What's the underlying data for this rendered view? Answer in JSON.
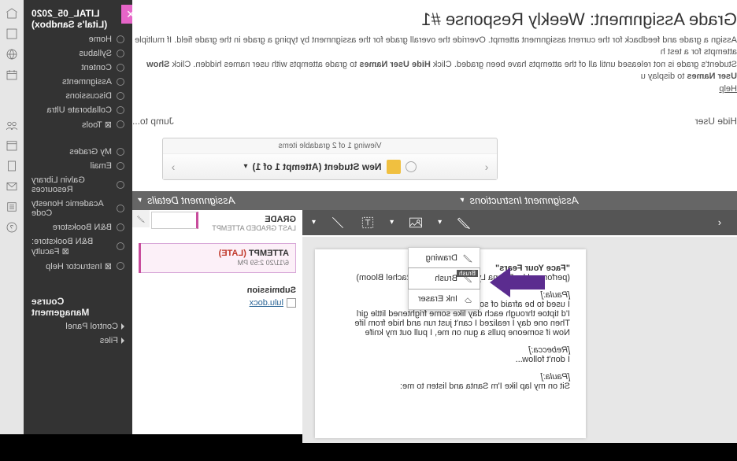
{
  "sidebar": {
    "courseTitle": "2020_05_LITAL (Lital's Sandbox)",
    "items": [
      {
        "label": "Home"
      },
      {
        "label": "Syllabus"
      },
      {
        "label": "Content"
      },
      {
        "label": "Assignments"
      },
      {
        "label": "Discussions"
      },
      {
        "label": "Collaborate Ultra"
      },
      {
        "label": "Tools ⊠"
      }
    ],
    "items2": [
      {
        "label": "My Grades"
      },
      {
        "label": "Email"
      },
      {
        "label": "Galvin Library Resources"
      },
      {
        "label": "Academic Honesty Code"
      },
      {
        "label": "B&N Bookstore"
      },
      {
        "label": "B&N Bookstore: Faculty ⊠"
      },
      {
        "label": "Instructor Help ⊠"
      }
    ],
    "courseMgmt": "Course Management",
    "controlPanel": "Control Panel",
    "files": "Files"
  },
  "header": {
    "title": "Grade Assignment: Weekly Response #1",
    "desc_a": "Assign a grade and feedback for the current assignment attempt. Override the overall grade for the assignment by typing a grade in the grade field. If multiple attempts for a test h",
    "desc_b": "Student's grade is not released until all of the attempts have been graded. Click ",
    "desc_b1": "Hide User Names",
    "desc_b2": " to grade attempts with user names hidden. Click ",
    "desc_b3": "Show User Names",
    "desc_b4": " to display u",
    "help": "Help"
  },
  "topbar": {
    "hide": "Hide User",
    "jump": "Jump to..."
  },
  "navbox": {
    "label": "Viewing 1 of 2 gradable items",
    "student": "New Student (Attempt 1 of 1)"
  },
  "sections": {
    "instr": "Assignment Instructions",
    "details": "Assignment Details"
  },
  "tool_dd": {
    "drawing": "Drawing",
    "brush": "Brush",
    "brush_hint": "Brush",
    "eraser": "Ink Eraser"
  },
  "gradepane": {
    "grade": "GRADE",
    "last": "LAST GRADED ATTEMPT",
    "attempt": "ATTEMPT",
    "late": " (LATE)",
    "ts": "6/11/20 2:59 PM",
    "submission": "Submission",
    "file": "lulu.docx"
  },
  "doc": {
    "t1": "\"Face Your Fears\"",
    "t2": "(performed by Donna Lynne Champlin & Rachel Bloom)",
    "p1a": "[Paula:]",
    "p1b": "I used to be afraid of so much in this world",
    "p1c": "I'd tiptoe through each day like some frightened little girl",
    "p1d": "Then one day I realized I can't just run and hide from life",
    "p1e": "Now if someone pulls a gun on me, I pull out my knife",
    "p2a": "[Rebecca:]",
    "p2b": "I don't follow...",
    "p3a": "[Paula:]",
    "p3b": "Sit on my lap like I'm Santa and listen to me:"
  }
}
